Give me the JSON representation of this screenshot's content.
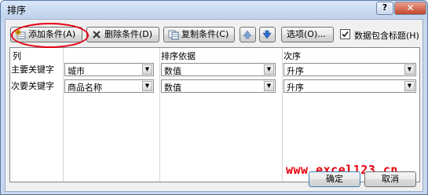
{
  "window": {
    "title": "排序",
    "help": "?",
    "close": "✕"
  },
  "toolbar": {
    "add_level": "添加条件(A)",
    "delete_level": "删除条件(D)",
    "copy_level": "复制条件(C)",
    "options": "选项(O)...",
    "has_headers_label": "数据包含标题(H)",
    "has_headers_checked": true
  },
  "grid": {
    "headers": {
      "column": "列",
      "sort_on": "排序依据",
      "order": "次序"
    },
    "rows": [
      {
        "label": "主要关键字",
        "column": "城市",
        "sort_on": "数值",
        "order": "升序"
      },
      {
        "label": "次要关键字",
        "column": "商品名称",
        "sort_on": "数值",
        "order": "升序"
      }
    ]
  },
  "footer": {
    "ok": "确定",
    "cancel": "取消"
  },
  "watermark": "www.excel123.cn",
  "colors": {
    "annotation": "#e50012",
    "watermark": "#e8000c"
  }
}
